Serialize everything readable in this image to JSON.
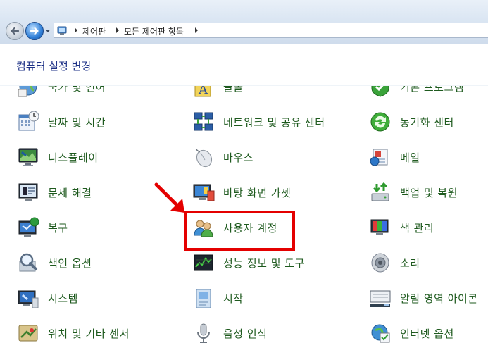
{
  "breadcrumb": {
    "items": [
      "제어판",
      "모든 제어판 항목"
    ]
  },
  "header": {
    "title": "컴퓨터 설정 변경"
  },
  "items": {
    "col1": [
      "국가 및 언어",
      "날짜 및 시간",
      "디스플레이",
      "문제 해결",
      "복구",
      "색인 옵션",
      "시스템",
      "위치 및 기타 센서"
    ],
    "col2": [
      "글꼴",
      "네트워크 및 공유 센터",
      "마우스",
      "바탕 화면 가젯",
      "사용자 계정",
      "성능 정보 및 도구",
      "시작",
      "음성 인식"
    ],
    "col3": [
      "기본 프로그램",
      "동기화 센터",
      "메일",
      "백업 및 복원",
      "색 관리",
      "소리",
      "알림 영역 아이콘",
      "인터넷 옵션"
    ]
  },
  "highlighted_item": "사용자 계정",
  "colors": {
    "link": "#1e5a1e",
    "header": "#1e3287",
    "highlight": "#e40000"
  },
  "icons": {
    "col1": [
      "region-icon",
      "calendar-icon",
      "monitor-icon",
      "troubleshoot-icon",
      "recovery-icon",
      "index-icon",
      "system-icon",
      "location-icon"
    ],
    "col2": [
      "fonts-icon",
      "network-icon",
      "mouse-icon",
      "gadget-icon",
      "user-accounts-icon",
      "performance-icon",
      "start-icon",
      "microphone-icon"
    ],
    "col3": [
      "default-programs-icon",
      "sync-icon",
      "mail-icon",
      "backup-icon",
      "color-icon",
      "speaker-icon",
      "notification-icon",
      "internet-icon"
    ]
  }
}
